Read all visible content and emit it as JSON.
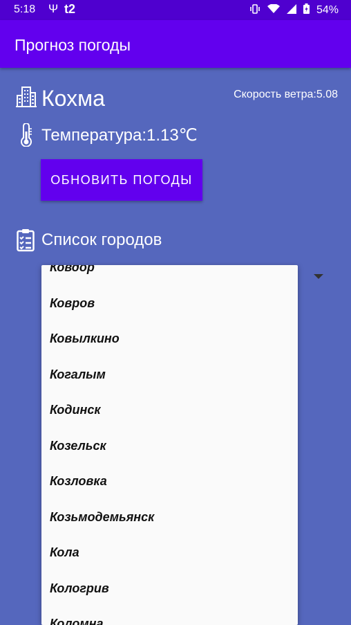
{
  "status_bar": {
    "time": "5:18",
    "carrier": "t2",
    "battery": "54%"
  },
  "app_bar": {
    "title": "Прогноз погоды"
  },
  "city": {
    "name": "Кохма"
  },
  "wind": {
    "text": "Скорость ветра:5.08"
  },
  "temperature": {
    "text": "Температура:1.13℃"
  },
  "refresh_button": {
    "label": "ОБНОВИТЬ ПОГОДЫ"
  },
  "city_list": {
    "label": "Список городов",
    "items": [
      "Ковдор",
      "Ковров",
      "Ковылкино",
      "Когалым",
      "Кодинск",
      "Козельск",
      "Козловка",
      "Козьмодемьянск",
      "Кола",
      "Кологрив",
      "Коломна"
    ]
  }
}
